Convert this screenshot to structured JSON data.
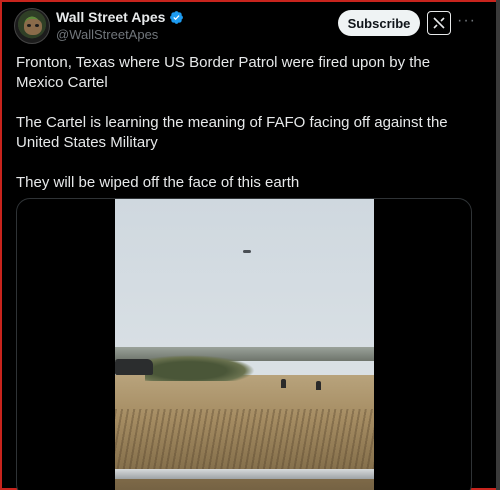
{
  "author": {
    "display_name": "Wall Street Apes",
    "handle": "@WallStreetApes",
    "verified": true
  },
  "actions": {
    "subscribe_label": "Subscribe",
    "grok_icon": "grok-icon",
    "more_label": "···"
  },
  "tweet": {
    "paragraphs": [
      "Fronton, Texas where US Border Patrol were fired upon by the Mexico Cartel",
      "The Cartel is learning the meaning of FAFO facing off against the United States Military",
      "They will be wiped off the face of this earth"
    ]
  },
  "colors": {
    "background": "#000000",
    "text": "#e7e9ea",
    "secondary_text": "#71767b",
    "verified_blue": "#1d9bf0",
    "subscribe_bg": "#eff3f4",
    "window_border": "#c8241d"
  }
}
